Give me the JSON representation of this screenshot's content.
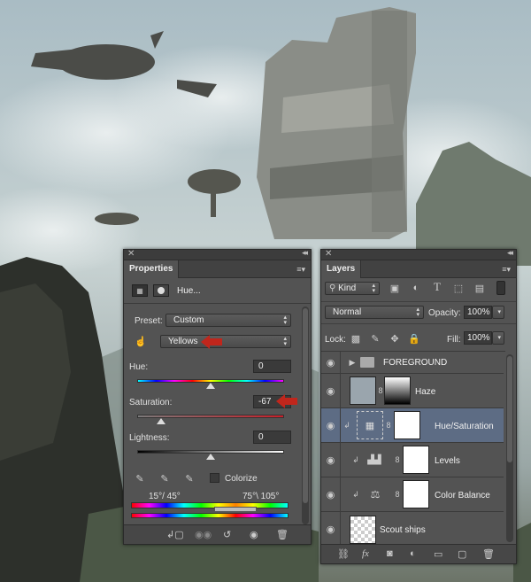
{
  "properties": {
    "tab": "Properties",
    "adjustment_title": "Hue...",
    "preset_label": "Preset:",
    "preset_value": "Custom",
    "channel_value": "Yellows",
    "hue_label": "Hue:",
    "hue_value": "0",
    "saturation_label": "Saturation:",
    "saturation_value": "-67",
    "lightness_label": "Lightness:",
    "lightness_value": "0",
    "colorize_label": "Colorize",
    "range_left": "15°/ 45°",
    "range_right": "75°\\ 105°",
    "hue_level": 0.5,
    "saturation_level": 0.165,
    "lightness_level": 0.5
  },
  "layers": {
    "tab": "Layers",
    "filter_kind": "Kind",
    "blend_mode": "Normal",
    "opacity_label": "Opacity:",
    "opacity_value": "100%",
    "lock_label": "Lock:",
    "fill_label": "Fill:",
    "fill_value": "100%",
    "items": [
      {
        "name": "FOREGROUND",
        "type": "group"
      },
      {
        "name": "Haze",
        "type": "gradient-mask"
      },
      {
        "name": "Hue/Saturation",
        "type": "adjustment",
        "selected": true
      },
      {
        "name": "Levels",
        "type": "adjustment"
      },
      {
        "name": "Color Balance",
        "type": "adjustment"
      },
      {
        "name": "Scout ships",
        "type": "pixel"
      }
    ]
  },
  "accent_colors": {
    "arrow": "#c0261c",
    "selection": "#5d6c84",
    "panel": "#535353"
  }
}
